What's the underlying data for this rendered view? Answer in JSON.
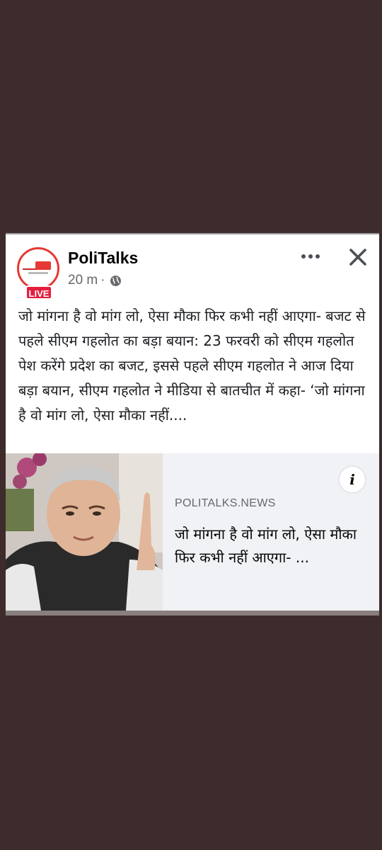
{
  "post": {
    "page_name": "PoliTalks",
    "time": "20 m",
    "separator": "·",
    "live_label": "LIVE",
    "privacy_icon": "globe-icon",
    "text": "जो मांगना है वो मांग लो, ऐसा मौका फिर कभी नहीं आएगा- बजट से पहले सीएम गहलोत का बड़ा बयान: 23 फरवरी को सीएम गहलोत पेश करेंगे प्रदेश का बजट, इससे पहले सीएम गहलोत ने आज दिया बड़ा बयान, सीएम गहलोत ने मीडिया से बातचीत में कहा- ‘जो मांगना है वो मांग लो, ऐसा मौका नहीं...."
  },
  "link_preview": {
    "domain": "POLITALKS.NEWS",
    "headline": "जो मांगना है वो मांग लो, ऐसा मौका फिर कभी नहीं आएगा- ...",
    "info_label": "i"
  },
  "colors": {
    "background": "#3e2c2c",
    "live": "#e41e3f",
    "preview_bg": "#f0f2f5"
  }
}
